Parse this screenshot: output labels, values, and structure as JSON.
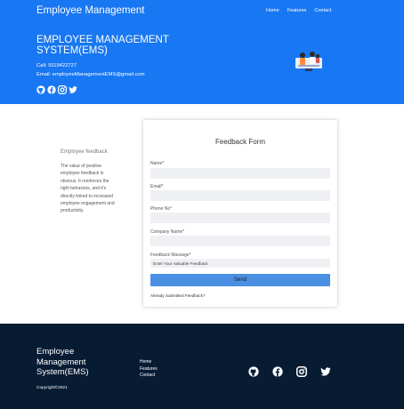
{
  "header": {
    "brand": "Employee Management",
    "nav": [
      "Home",
      "Features",
      "Contact"
    ]
  },
  "hero": {
    "title": "EMPLOYEE MANAGEMENT SYSTEM(EMS)",
    "call": "Call: 9119422727",
    "email": "Email: employeeManagementEMS@gmail.com",
    "social_icons": [
      "github-icon",
      "facebook-icon",
      "instagram-icon",
      "twitter-icon"
    ]
  },
  "sidebar": {
    "title": "Employee feedback",
    "text": "The value of positive employee feedback is obvious. It reinforces the right behaviors, and it's directly linked to increased employee engagement and productivity."
  },
  "form": {
    "title": "Feedback Form",
    "name_label": "Name*",
    "name_value": "",
    "email_label": "Email*",
    "email_value": "",
    "phone_label": "Phone No*",
    "phone_value": "",
    "company_label": "Company Name*",
    "company_value": "",
    "message_label": "Feedback Massage*",
    "message_placeholder": "Enter Your Valuable Feedback",
    "send_label": "Send",
    "already_text": "Already Submitted Feedback?"
  },
  "footer": {
    "brand": "Employee Management System(EMS)",
    "copyright": "Copyright©2021",
    "links": [
      "Home",
      "Features",
      "Contact"
    ],
    "social_icons": [
      "github-icon",
      "facebook-icon",
      "instagram-icon",
      "twitter-icon"
    ]
  },
  "colors": {
    "primary": "#1877f2",
    "footer_bg": "#071b33",
    "button": "#4a90e2",
    "field_bg": "#eef0f4"
  }
}
